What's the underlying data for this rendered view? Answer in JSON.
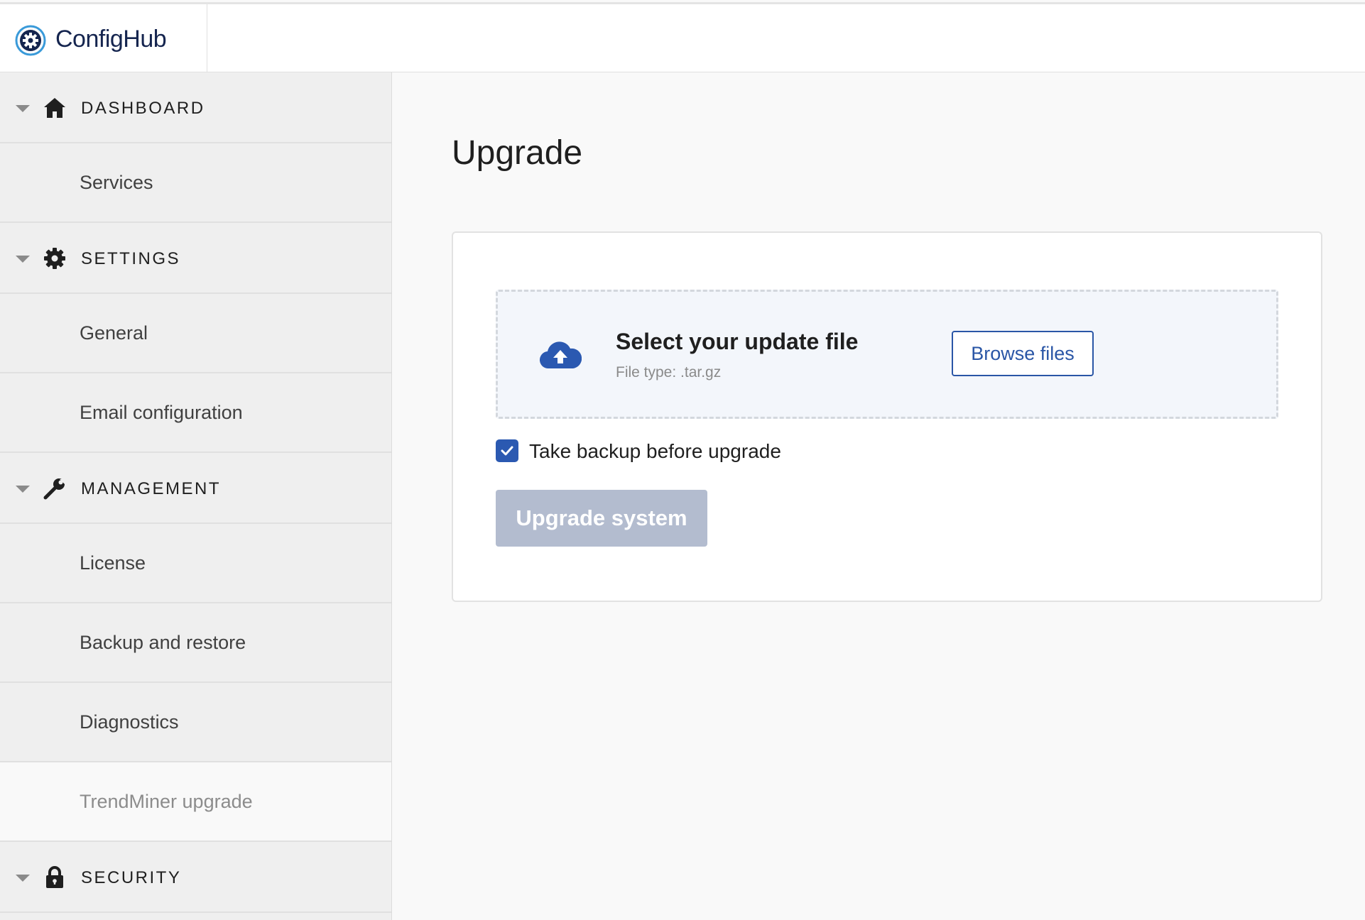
{
  "app": {
    "logo_text": "ConfigHub",
    "accent_color": "#2a56a6"
  },
  "sidebar": {
    "sections": [
      {
        "label": "DASHBOARD",
        "icon": "home-icon",
        "items": [
          {
            "label": "Services"
          }
        ]
      },
      {
        "label": "SETTINGS",
        "icon": "gear-icon",
        "items": [
          {
            "label": "General"
          },
          {
            "label": "Email configuration"
          }
        ]
      },
      {
        "label": "MANAGEMENT",
        "icon": "wrench-icon",
        "items": [
          {
            "label": "License"
          },
          {
            "label": "Backup and restore"
          },
          {
            "label": "Diagnostics"
          },
          {
            "label": "TrendMiner upgrade",
            "active": true
          }
        ]
      },
      {
        "label": "SECURITY",
        "icon": "lock-icon",
        "items": []
      }
    ]
  },
  "main": {
    "title": "Upgrade",
    "upload": {
      "icon": "cloud-upload-icon",
      "title": "Select your update file",
      "subtitle": "File type: .tar.gz",
      "browse_label": "Browse files"
    },
    "backup_checkbox": {
      "label": "Take backup before upgrade",
      "checked": true
    },
    "upgrade_button": {
      "label": "Upgrade system",
      "disabled": true
    }
  }
}
